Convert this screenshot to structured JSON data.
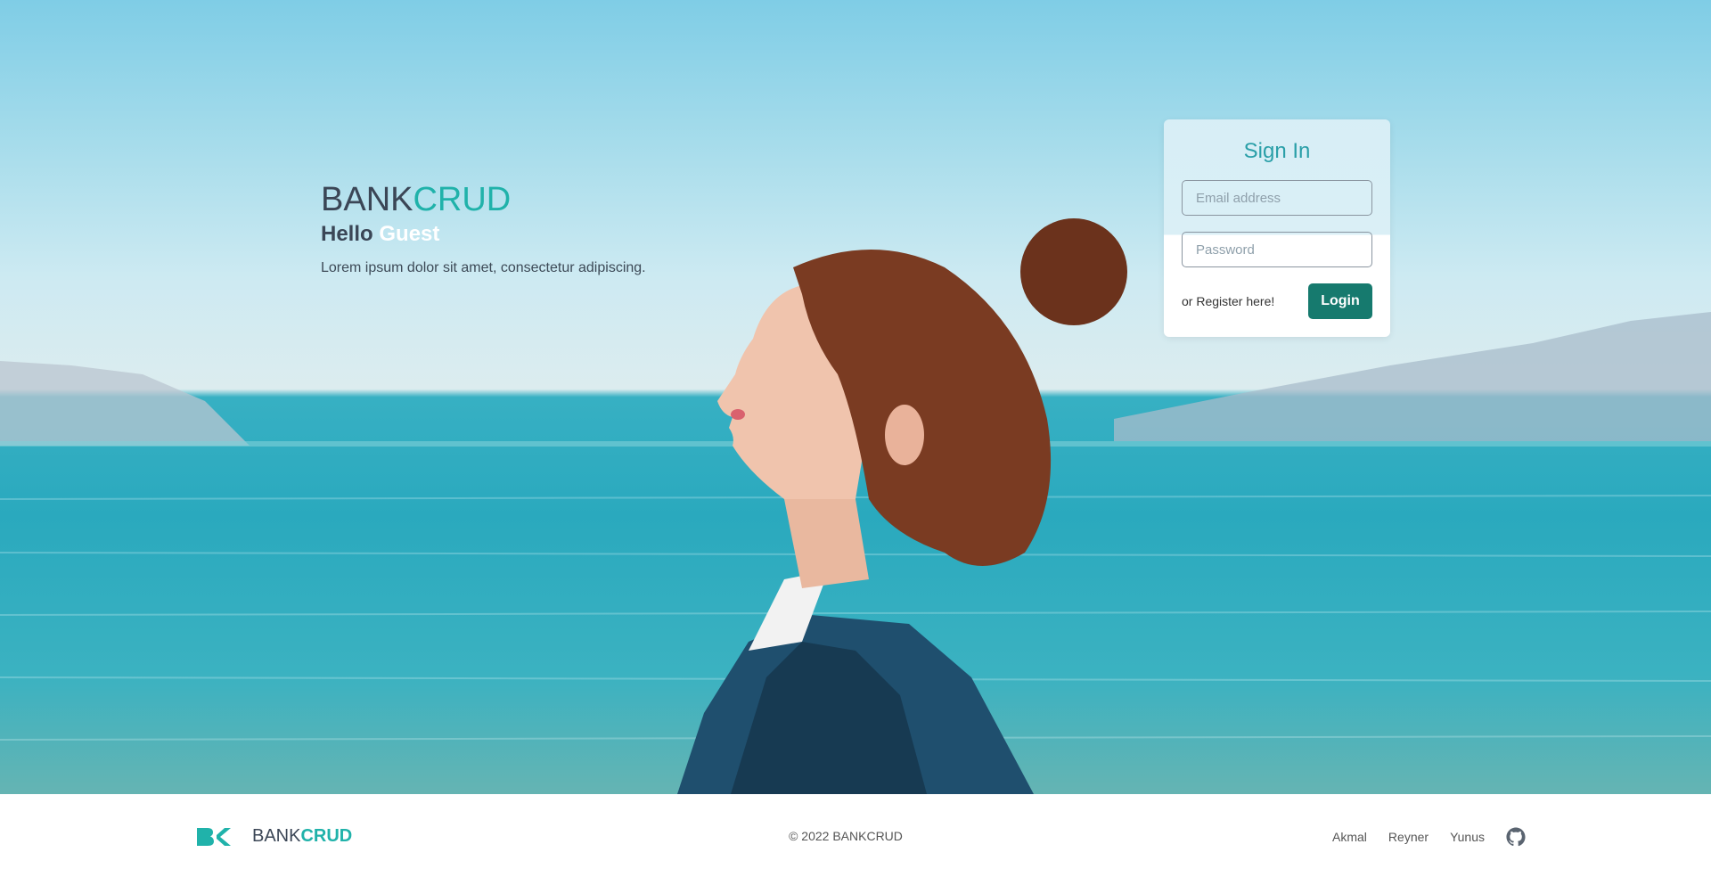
{
  "brand": {
    "name_main": "BANK",
    "name_accent": "CRUD"
  },
  "hero": {
    "hello": "Hello",
    "guest": "Guest",
    "description": "Lorem ipsum dolor sit amet, consectetur adipiscing."
  },
  "signin": {
    "title": "Sign In",
    "email_placeholder": "Email address",
    "password_placeholder": "Password",
    "register_link": "or Register here!",
    "login_button": "Login"
  },
  "footer": {
    "logo_icon": "bc-logo-icon",
    "brand_main": "BANK",
    "brand_accent": "CRUD",
    "copyright": "© 2022 BANKCRUD",
    "links": [
      "Akmal",
      "Reyner",
      "Yunus"
    ],
    "github_icon": "github-icon"
  },
  "colors": {
    "accent": "#20b2aa",
    "button": "#167a6e",
    "text_dark": "#3b4656"
  }
}
